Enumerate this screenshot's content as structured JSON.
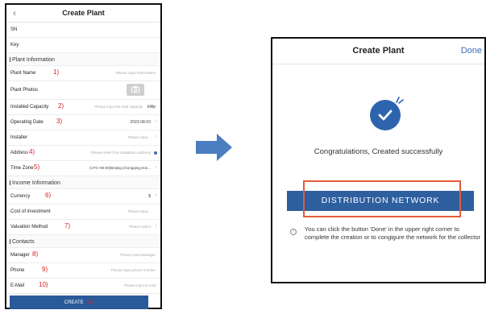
{
  "left": {
    "title": "Create Plant",
    "back_icon": "chevron-left-icon",
    "sn_label": "SN",
    "key_label": "Key",
    "plant_section": "Plant Information",
    "plant_name": {
      "label": "Plant Name",
      "num": "1)",
      "placeholder": "Please input Plant Name"
    },
    "plant_photos": {
      "label": "Plant Photos",
      "icon": "camera-icon"
    },
    "installed_capacity": {
      "label": "Installed Capacity",
      "num": "2)",
      "placeholder": "Please input the total capacity",
      "unit": "kWp"
    },
    "operating_date": {
      "label": "Operating Date",
      "num": "3)",
      "value": "2023-08-03"
    },
    "installer": {
      "label": "Installer",
      "placeholder": "Please input..."
    },
    "address": {
      "label": "Address",
      "num": "4)",
      "placeholder": "Please select the installation address",
      "icon": "location-icon"
    },
    "time_zone": {
      "label": "Time Zone",
      "num": "5)",
      "value": "(UTC+08:00)Beijing,Chongqing,Hon..."
    },
    "income_section": "Income Information",
    "currency": {
      "label": "Currency",
      "num": "6)",
      "value": "$"
    },
    "cost": {
      "label": "Cost of investment",
      "placeholder": "Please input..."
    },
    "valuation": {
      "label": "Valuation Method",
      "num": "7)",
      "placeholder": "Please select"
    },
    "contacts_section": "Contacts",
    "manager": {
      "label": "Manager",
      "num": "8)",
      "placeholder": "Please input Manager"
    },
    "phone": {
      "label": "Phone",
      "num": "9)",
      "placeholder": "Please input phone number"
    },
    "email": {
      "label": "E-Mail",
      "num": "10)",
      "placeholder": "Please input E-mail"
    },
    "create_button": "CREATE",
    "create_num": "11)"
  },
  "right": {
    "title": "Create Plant",
    "done_label": "Done",
    "success_icon": "check-circle-icon",
    "congrats": "Congratulations, Created successfully",
    "distribution_button": "DISTRIBUTION NETWORK",
    "info_icon": "info-icon",
    "info_text": "You can click the button 'Done' in the upper right corner to complete the creation or to congigure the network for the collector"
  },
  "colors": {
    "primary_blue": "#2e5f9f",
    "highlight_red": "#d62020",
    "outline_orange": "#e25b3a",
    "arrow_blue": "#4a7ec0"
  }
}
